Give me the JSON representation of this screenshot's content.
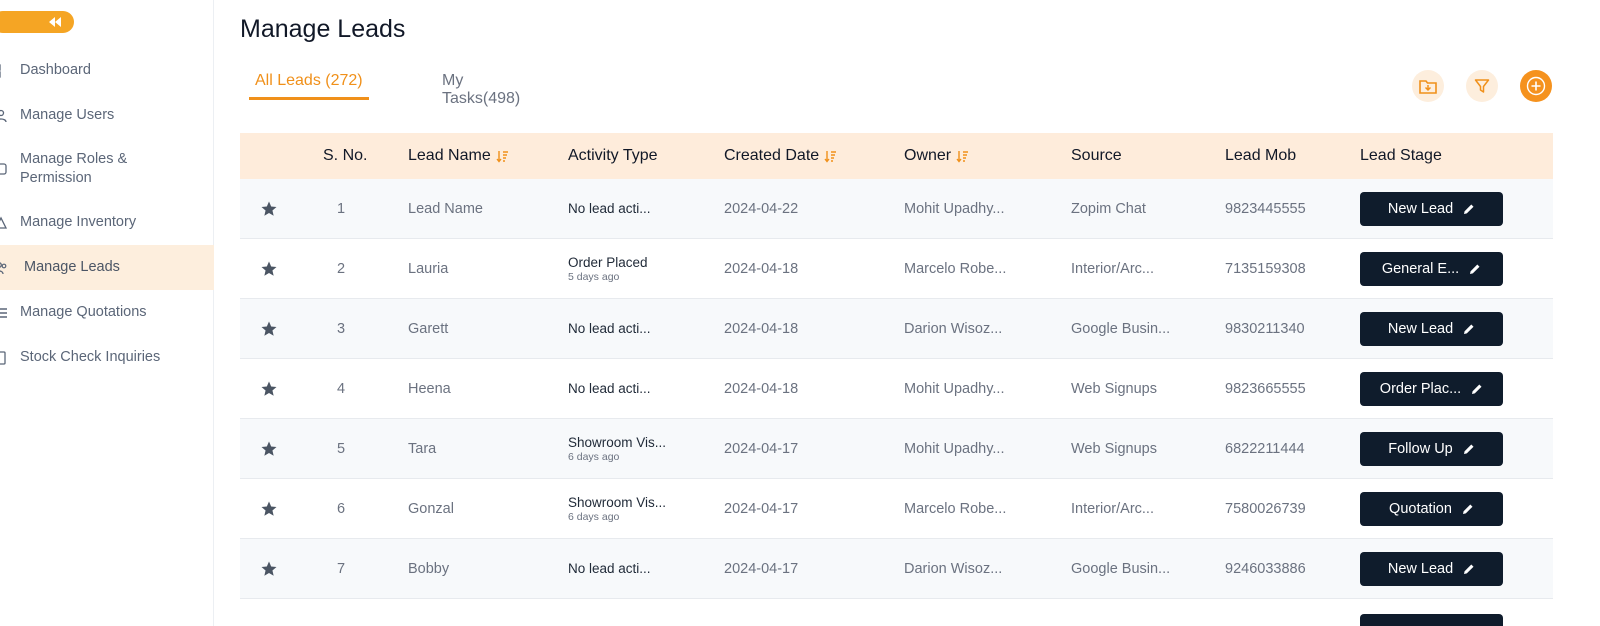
{
  "sidebar": {
    "items": [
      {
        "label": "Dashboard",
        "icon": "dashboard-icon"
      },
      {
        "label": "Manage Users",
        "icon": "users-icon"
      },
      {
        "label": "Manage Roles & Permission",
        "line1": "Manage Roles &",
        "line2": "Permission",
        "icon": "roles-icon"
      },
      {
        "label": "Manage Inventory",
        "icon": "inventory-icon"
      },
      {
        "label": "Manage Leads",
        "icon": "leads-icon",
        "active": true
      },
      {
        "label": "Manage Quotations",
        "icon": "quotations-icon"
      },
      {
        "label": "Stock Check Inquiries",
        "icon": "stock-icon"
      }
    ]
  },
  "header": {
    "title": "Manage Leads",
    "tabs": [
      {
        "label": "All Leads (272)",
        "active": true
      },
      {
        "label": "My Tasks(498)",
        "active": false
      }
    ]
  },
  "table": {
    "headers": [
      "S. No.",
      "Lead Name",
      "Activity Type",
      "Created Date",
      "Owner",
      "Source",
      "Lead Mob",
      "Lead Stage"
    ],
    "rows": [
      {
        "sno": "1",
        "name": "Lead Name",
        "activity": "No lead acti...",
        "activity_sub": "",
        "date": "2024-04-22",
        "owner": "Mohit Upadhy...",
        "source": "Zopim Chat",
        "mob": "9823445555",
        "stage": "New Lead"
      },
      {
        "sno": "2",
        "name": "Lauria",
        "activity": "Order Placed",
        "activity_sub": "5 days ago",
        "date": "2024-04-18",
        "owner": "Marcelo Robe...",
        "source": "Interior/Arc...",
        "mob": "7135159308",
        "stage": "General E..."
      },
      {
        "sno": "3",
        "name": "Garett",
        "activity": "No lead acti...",
        "activity_sub": "",
        "date": "2024-04-18",
        "owner": "Darion Wisoz...",
        "source": "Google Busin...",
        "mob": "9830211340",
        "stage": "New Lead"
      },
      {
        "sno": "4",
        "name": "Heena",
        "activity": "No lead acti...",
        "activity_sub": "",
        "date": "2024-04-18",
        "owner": "Mohit Upadhy...",
        "source": "Web Signups",
        "mob": "9823665555",
        "stage": "Order Plac..."
      },
      {
        "sno": "5",
        "name": "Tara",
        "activity": "Showroom Vis...",
        "activity_sub": "6 days ago",
        "date": "2024-04-17",
        "owner": "Mohit Upadhy...",
        "source": "Web Signups",
        "mob": "6822211444",
        "stage": "Follow Up"
      },
      {
        "sno": "6",
        "name": "Gonzal",
        "activity": "Showroom Vis...",
        "activity_sub": "6 days ago",
        "date": "2024-04-17",
        "owner": "Marcelo Robe...",
        "source": "Interior/Arc...",
        "mob": "7580026739",
        "stage": "Quotation"
      },
      {
        "sno": "7",
        "name": "Bobby",
        "activity": "No lead acti...",
        "activity_sub": "",
        "date": "2024-04-17",
        "owner": "Darion Wisoz...",
        "source": "Google Busin...",
        "mob": "9246033886",
        "stage": "New Lead"
      }
    ]
  },
  "colors": {
    "accent": "#f5921e",
    "header_bg": "#feecdb",
    "stage_bg": "#0f1c2c",
    "active_nav_bg": "#fdeedd"
  }
}
